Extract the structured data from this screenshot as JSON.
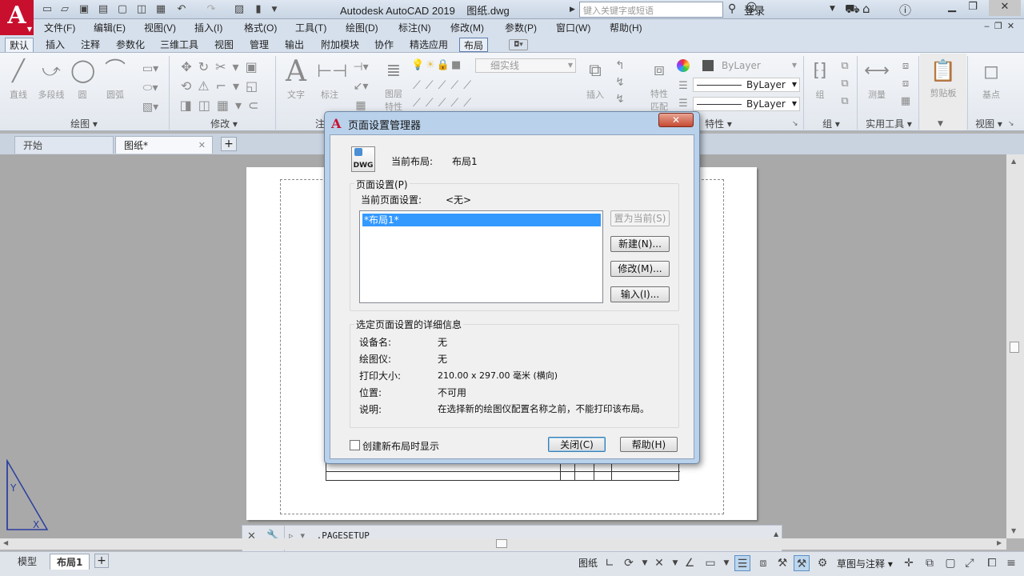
{
  "app": {
    "title": "Autodesk AutoCAD 2019",
    "file": "图纸.dwg",
    "search_placeholder": "键入关键字或短语",
    "login_label": "登录",
    "logo_letter": "A"
  },
  "menu": [
    "文件(F)",
    "编辑(E)",
    "视图(V)",
    "插入(I)",
    "格式(O)",
    "工具(T)",
    "绘图(D)",
    "标注(N)",
    "修改(M)",
    "参数(P)",
    "窗口(W)",
    "帮助(H)"
  ],
  "ribbon_tabs": [
    "默认",
    "插入",
    "注释",
    "参数化",
    "三维工具",
    "视图",
    "管理",
    "输出",
    "附加模块",
    "协作",
    "精选应用",
    "布局"
  ],
  "ribbon": {
    "draw_tools": [
      "直线",
      "多段线",
      "圆",
      "圆弧"
    ],
    "draw_panel": "绘图",
    "modify_panel": "修改",
    "annotation_tools": [
      "文字",
      "标注"
    ],
    "annotation_panel": "注释",
    "layer_tools": [
      "图层",
      "特性"
    ],
    "layer_dropdown": "细实线",
    "insert_label": "插入",
    "match_label": "特性",
    "match_label2": "匹配",
    "bylayer_color": "ByLayer",
    "bylayer_linetype": "ByLayer",
    "bylayer_lineweight": "ByLayer",
    "properties_panel": "特性",
    "group_label": "组",
    "group_panel": "组",
    "measure_label": "测量",
    "utilities_panel": "实用工具",
    "clipboard_label": "剪贴板",
    "base_label": "基点",
    "view_panel": "视图"
  },
  "doc_tabs": [
    {
      "label": "开始"
    },
    {
      "label": "图纸*"
    }
  ],
  "command_line": "_.PAGESETUP",
  "layout_tabs": [
    "模型",
    "布局1"
  ],
  "status": {
    "paper_label": "图纸",
    "workspace": "草图与注释"
  },
  "dialog": {
    "title": "页面设置管理器",
    "current_layout_label": "当前布局:",
    "current_layout_value": "布局1",
    "dwg_icon_text": "DWG",
    "page_setup_group": "页面设置(P)",
    "current_page_setup_label": "当前页面设置:",
    "current_page_setup_value": "<无>",
    "list_items": [
      "*布局1*"
    ],
    "buttons": {
      "set_current": "置为当前(S)",
      "new": "新建(N)...",
      "modify": "修改(M)...",
      "import": "输入(I)..."
    },
    "details_group": "选定页面设置的详细信息",
    "details": [
      {
        "label": "设备名:",
        "value": "无"
      },
      {
        "label": "绘图仪:",
        "value": "无"
      },
      {
        "label": "打印大小:",
        "value": "210.00 x 297.00 毫米 (横向)"
      },
      {
        "label": "位置:",
        "value": "不可用"
      },
      {
        "label": "说明:",
        "value": "在选择新的绘图仪配置名称之前，不能打印该布局。"
      }
    ],
    "checkbox_label": "创建新布局时显示",
    "close_button": "关闭(C)",
    "help_button": "帮助(H)"
  }
}
